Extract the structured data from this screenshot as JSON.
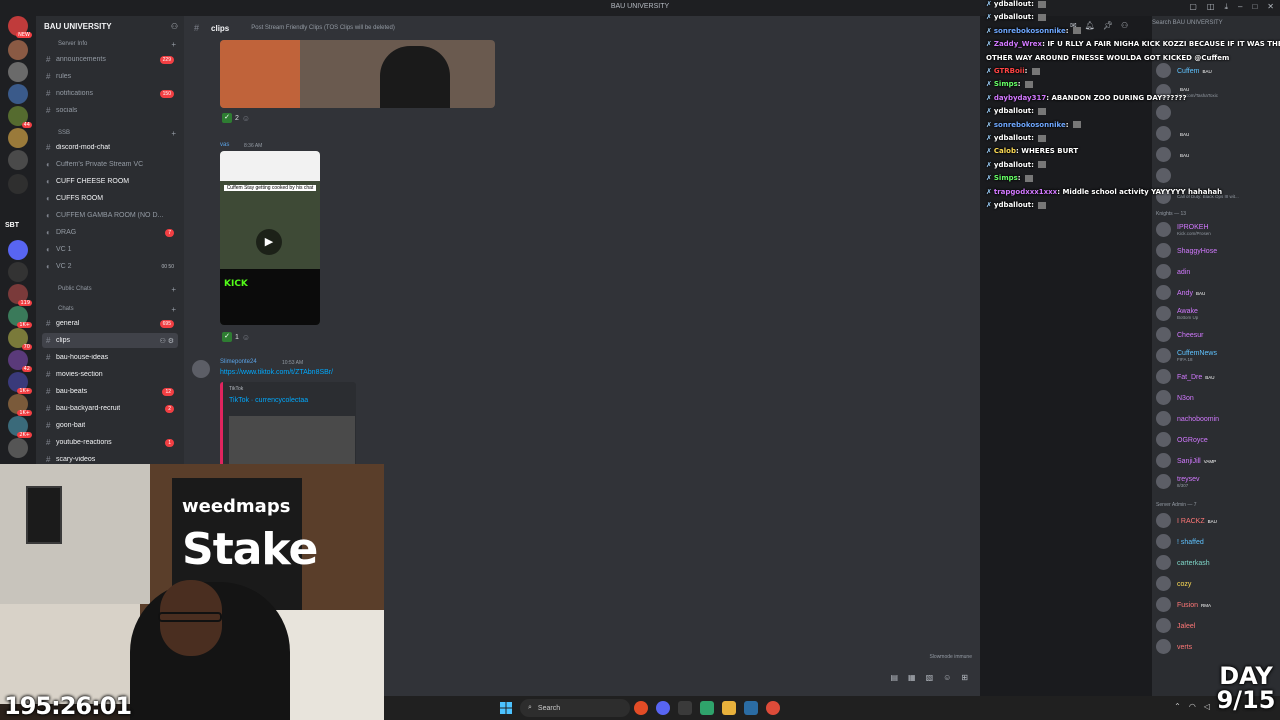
{
  "window": {
    "title": "BAU UNIVERSITY"
  },
  "server": {
    "name": "BAU UNIVERSITY",
    "rail_label": "SBT",
    "rail_top_badge": "NEW"
  },
  "rail_badges": [
    "44",
    "119",
    "1K+",
    "70",
    "42",
    "1K+",
    "1K+",
    "2K+"
  ],
  "categories": [
    {
      "label": "Server Info"
    },
    {
      "label": "SSB"
    },
    {
      "label": "Public Chats"
    },
    {
      "label": "Chats"
    }
  ],
  "channels": [
    {
      "name": "announcements",
      "count": "229"
    },
    {
      "name": "rules",
      "count": ""
    },
    {
      "name": "notifications",
      "count": "150"
    },
    {
      "name": "socials",
      "count": ""
    },
    {
      "name": "discord-mod-chat",
      "count": ""
    },
    {
      "name": "Cuffem's Private Stream VC",
      "count": ""
    },
    {
      "name": "CUFF CHEESE ROOM",
      "count": ""
    },
    {
      "name": "CUFFS ROOM",
      "count": ""
    },
    {
      "name": "CUFFEM GAMBA ROOM (NO D...",
      "count": ""
    },
    {
      "name": "DRAG",
      "count": "7"
    },
    {
      "name": "VC 1",
      "count": ""
    },
    {
      "name": "VC 2",
      "count": "00 50"
    },
    {
      "name": "general",
      "count": "695"
    },
    {
      "name": "clips",
      "count": ""
    },
    {
      "name": "bau-house-ideas",
      "count": ""
    },
    {
      "name": "movies-section",
      "count": ""
    },
    {
      "name": "bau-beats",
      "count": "12"
    },
    {
      "name": "bau-backyard-recruit",
      "count": "2"
    },
    {
      "name": "goon-bait",
      "count": ""
    },
    {
      "name": "youtube-reactions",
      "count": "1"
    },
    {
      "name": "scary-videos",
      "count": ""
    }
  ],
  "chat": {
    "channel": "clips",
    "topic": "Post Stream Friendly Clips (TOS Clips will be deleted)",
    "msg1_reaction": "2",
    "msg2_author": "vas",
    "msg2_time": "8:36 AM",
    "video_caption": "Cuffem Stay getting cooked by his chat",
    "video_brand": "KICK",
    "msg2_reaction": "1",
    "msg3_author": "Slimeponte24",
    "msg3_time": "10:53 AM",
    "msg3_link": "https://www.tiktok.com/t/ZTAbn8SBr/",
    "embed_provider": "TikTok",
    "embed_title": "TikTok · currencycolectaa",
    "footer": "Slowmode immune"
  },
  "stream_chat": [
    {
      "user": "ydballout",
      "color": "#ffffff",
      "text": ""
    },
    {
      "user": "ydballout",
      "color": "#ffffff",
      "text": ""
    },
    {
      "user": "sonrebokosonnike",
      "color": "#6fa8ff",
      "text": ""
    },
    {
      "user": "Zaddy_Wrex",
      "color": "#d279ff",
      "text": "IF U RLLY A FAIR NIGHA KICK KOZZI BECAUSE IF IT WAS THE"
    },
    {
      "user": "",
      "color": "#ffffff",
      "text": "OTHER WAY AROUND FINESSE WOULDA GOT KICKED @Cuffem"
    },
    {
      "user": "GTRBoii",
      "color": "#ff4444",
      "text": ""
    },
    {
      "user": "Simps",
      "color": "#66ff66",
      "text": ""
    },
    {
      "user": "daybyday317",
      "color": "#d279ff",
      "text": "ABANDON ZOO DURING DAY??????"
    },
    {
      "user": "ydballout",
      "color": "#ffffff",
      "text": ""
    },
    {
      "user": "sonrebokosonnike",
      "color": "#6fa8ff",
      "text": ""
    },
    {
      "user": "ydballout",
      "color": "#ffffff",
      "text": ""
    },
    {
      "user": "Calob",
      "color": "#ffdd55",
      "text": "WHERES BURT"
    },
    {
      "user": "ydballout",
      "color": "#ffffff",
      "text": ""
    },
    {
      "user": "Simps",
      "color": "#66ff66",
      "text": ""
    },
    {
      "user": "trapgodxxx1xxx",
      "color": "#d279ff",
      "text": "Middle school activity YAYYYYY hahahah"
    },
    {
      "user": "ydballout",
      "color": "#ffffff",
      "text": ""
    }
  ],
  "members_panel": {
    "search_placeholder": "Search BAU UNIVERSITY",
    "groups": [
      {
        "label": "Knights — 13"
      },
      {
        "label": "Server Admin — 7"
      }
    ],
    "top": [
      {
        "name": "Cuffem",
        "color": "#5fc3ff",
        "tag": "BAU",
        "sub": ""
      },
      {
        "name": "",
        "color": "#d279ff",
        "tag": "BAU",
        "sub": "kick.com/TashaToxic"
      },
      {
        "name": "",
        "color": "#b5bac1",
        "tag": "",
        "sub": ""
      },
      {
        "name": "",
        "color": "#b5bac1",
        "tag": "BAU",
        "sub": ""
      },
      {
        "name": "",
        "color": "#b5bac1",
        "tag": "BAU",
        "sub": ""
      },
      {
        "name": "",
        "color": "#b5bac1",
        "tag": "",
        "sub": ""
      },
      {
        "name": "",
        "color": "#b5bac1",
        "tag": "",
        "sub": "Call of Duty: Black Ops III wit..."
      }
    ],
    "knights": [
      {
        "name": "IPROKEH",
        "color": "#d279ff",
        "tag": "",
        "sub": "Kick.com/Prosen"
      },
      {
        "name": "ShaggyHose",
        "color": "#d279ff",
        "tag": "",
        "sub": ""
      },
      {
        "name": "adin",
        "color": "#d279ff",
        "tag": "",
        "sub": ""
      },
      {
        "name": "Andy",
        "color": "#d279ff",
        "tag": "BAU",
        "sub": ""
      },
      {
        "name": "Awake",
        "color": "#d279ff",
        "tag": "",
        "sub": "Bottom Up"
      },
      {
        "name": "Cheesur",
        "color": "#d279ff",
        "tag": "",
        "sub": ""
      },
      {
        "name": "CuffemNews",
        "color": "#5fc3ff",
        "tag": "",
        "sub": "FIFA 18"
      },
      {
        "name": "Fat_Dre",
        "color": "#d279ff",
        "tag": "BAU",
        "sub": ""
      },
      {
        "name": "N3on",
        "color": "#d279ff",
        "tag": "",
        "sub": ""
      },
      {
        "name": "nachoboomin",
        "color": "#d279ff",
        "tag": "",
        "sub": ""
      },
      {
        "name": "OGRoyce",
        "color": "#d279ff",
        "tag": "",
        "sub": ""
      },
      {
        "name": "SanjiJill",
        "color": "#d279ff",
        "tag": "VAMP",
        "sub": ""
      },
      {
        "name": "treysev",
        "color": "#d279ff",
        "tag": "",
        "sub": "8/307"
      }
    ],
    "admins": [
      {
        "name": "I RACKZ",
        "color": "#ff7777",
        "tag": "BAU",
        "sub": ""
      },
      {
        "name": "! shaffed",
        "color": "#5fc3ff",
        "tag": "",
        "sub": ""
      },
      {
        "name": "carterkash",
        "color": "#7fd6c8",
        "tag": "",
        "sub": ""
      },
      {
        "name": "cozy",
        "color": "#ffdd55",
        "tag": "",
        "sub": ""
      },
      {
        "name": "Fusion",
        "color": "#ff7777",
        "tag": "RMA",
        "sub": ""
      },
      {
        "name": "Jaleel",
        "color": "#ff7777",
        "tag": "",
        "sub": ""
      },
      {
        "name": "verts",
        "color": "#ff7777",
        "tag": "",
        "sub": ""
      }
    ]
  },
  "webcam": {
    "banner_top": "weedmaps",
    "banner_main": "Stake"
  },
  "stream_timer": "195:26:01",
  "day_counter": {
    "line1": "DAY",
    "line2": "9/15"
  },
  "taskbar": {
    "search": "Search"
  },
  "colors": {
    "accent": "#5865f2",
    "danger": "#f23f43",
    "link": "#00a8fc",
    "bg": "#313338"
  }
}
